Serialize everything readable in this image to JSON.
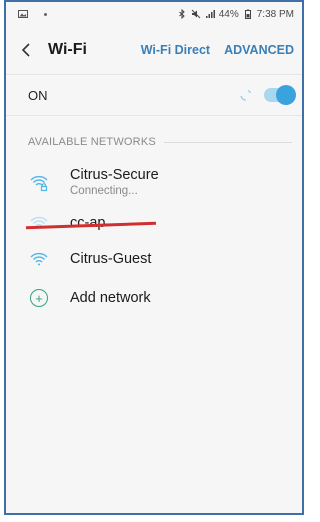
{
  "status_bar": {
    "time": "7:38 PM",
    "battery": "44%",
    "icons": [
      "gallery-icon",
      "bluetooth-icon",
      "mute-icon",
      "signal-icon",
      "battery-icon"
    ]
  },
  "header": {
    "title": "Wi-Fi",
    "wifi_direct": "Wi-Fi Direct",
    "advanced": "ADVANCED"
  },
  "toggle_row": {
    "label": "ON",
    "state": true
  },
  "section": {
    "available_networks": "AVAILABLE NETWORKS"
  },
  "networks": [
    {
      "name": "Citrus-Secure",
      "status": "Connecting...",
      "icon": "wifi-lock-icon"
    },
    {
      "name": "cc-ap",
      "icon": "wifi-icon",
      "struck_out": true
    },
    {
      "name": "Citrus-Guest",
      "icon": "wifi-icon"
    }
  ],
  "add_network": {
    "label": "Add network",
    "icon": "plus-icon"
  },
  "colors": {
    "accent": "#3b7fb8",
    "toggle": "#3aa2dc",
    "wifi": "#4fb6e8",
    "add": "#2fa67a",
    "strike": "#d12f2f"
  }
}
